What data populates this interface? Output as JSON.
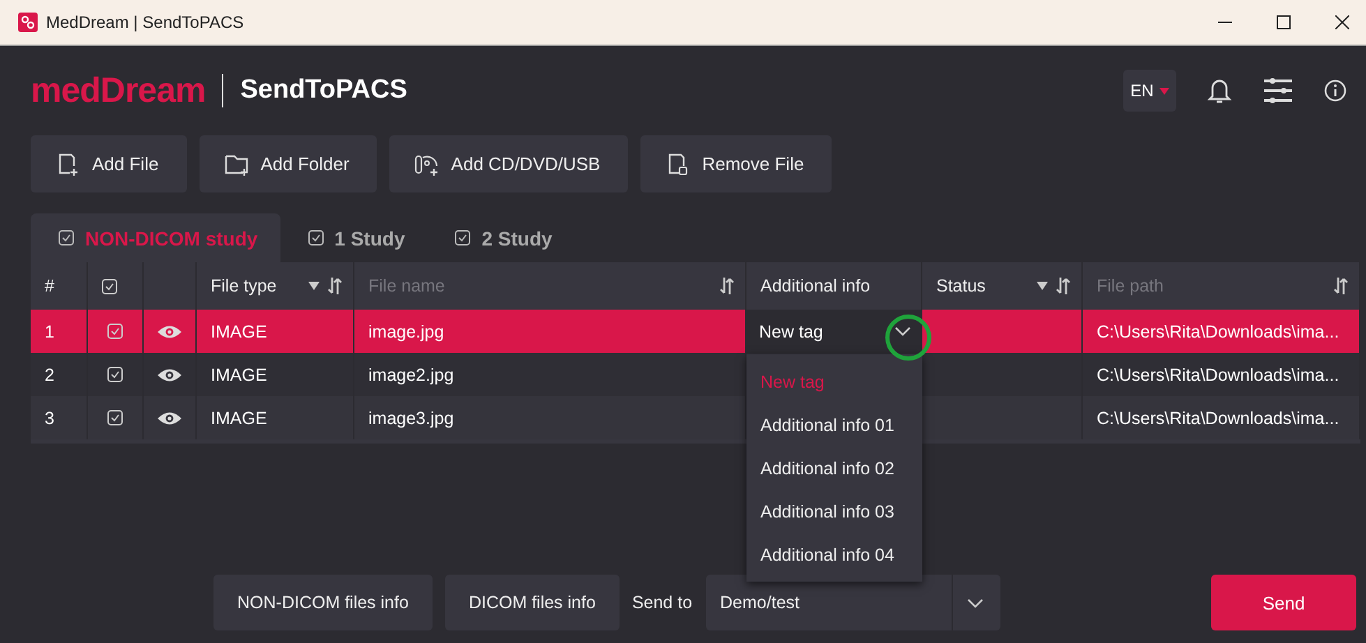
{
  "window": {
    "title": "MedDream | SendToPACS"
  },
  "header": {
    "logo": "medDream",
    "app_name": "SendToPACS",
    "language": "EN"
  },
  "toolbar": [
    {
      "label": "Add File",
      "kind": "file"
    },
    {
      "label": "Add Folder",
      "kind": "folder"
    },
    {
      "label": "Add CD/DVD/USB",
      "kind": "disc"
    },
    {
      "label": "Remove File",
      "kind": "remove"
    }
  ],
  "tabs": [
    {
      "label": "NON-DICOM study",
      "selected": true
    },
    {
      "label": "1 Study",
      "selected": false
    },
    {
      "label": "2 Study",
      "selected": false
    }
  ],
  "table": {
    "columns": [
      {
        "kind": "text",
        "label": "#"
      },
      {
        "kind": "check"
      },
      {
        "kind": "blank"
      },
      {
        "kind": "text",
        "label": "File type",
        "filter": true,
        "sort": true
      },
      {
        "kind": "placeholder",
        "label": "File name",
        "filter": false,
        "sort": true
      },
      {
        "kind": "text",
        "label": "Additional info"
      },
      {
        "kind": "text",
        "label": "Status",
        "filter": true,
        "sort": true
      },
      {
        "kind": "placeholder",
        "label": "File path",
        "filter": false,
        "sort": true
      }
    ],
    "rows": [
      {
        "number": "1",
        "checked": true,
        "selected": true,
        "file_type": "IMAGE",
        "file_name": "image.jpg",
        "additional_info": "New tag",
        "file_path": "C:\\Users\\Rita\\Downloads\\ima..."
      },
      {
        "number": "2",
        "checked": true,
        "selected": false,
        "file_type": "IMAGE",
        "file_name": "image2.jpg",
        "file_path": "C:\\Users\\Rita\\Downloads\\ima..."
      },
      {
        "number": "3",
        "checked": true,
        "selected": false,
        "file_type": "IMAGE",
        "file_name": "image3.jpg",
        "file_path": "C:\\Users\\Rita\\Downloads\\ima..."
      }
    ]
  },
  "dropdown": {
    "options": [
      {
        "label": "New tag",
        "selected": true
      },
      {
        "label": "Additional info 01",
        "selected": false
      },
      {
        "label": "Additional info 02",
        "selected": false
      },
      {
        "label": "Additional info 03",
        "selected": false
      },
      {
        "label": "Additional info 04",
        "selected": false
      }
    ]
  },
  "footer": {
    "buttons": [
      "NON-DICOM files info",
      "DICOM files info"
    ],
    "send_to_label": "Send to",
    "send_to_value": "Demo/test",
    "send_button": "Send"
  }
}
